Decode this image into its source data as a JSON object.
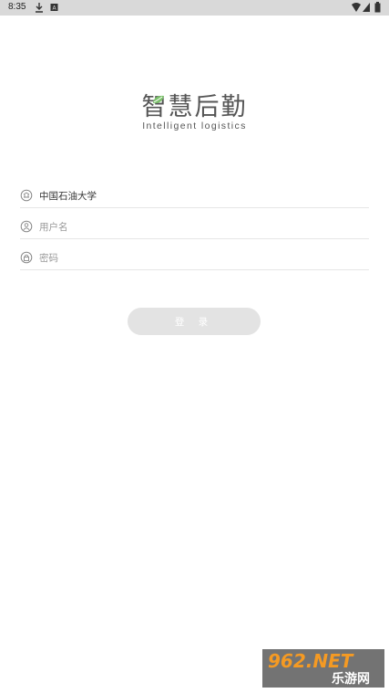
{
  "status_bar": {
    "time": "8:35"
  },
  "logo": {
    "title": "智慧后勤",
    "subtitle": "Intelligent logistics"
  },
  "form": {
    "school": {
      "value": "中国石油大学"
    },
    "username": {
      "placeholder": "用户名"
    },
    "password": {
      "placeholder": "密码"
    },
    "login_label": "登 录"
  },
  "watermark": {
    "top": "962.NET",
    "bottom": "乐游网"
  },
  "colors": {
    "logo_green": "#7cc26c",
    "button_bg": "#e3e3e3",
    "divider": "#e6e6e6"
  }
}
